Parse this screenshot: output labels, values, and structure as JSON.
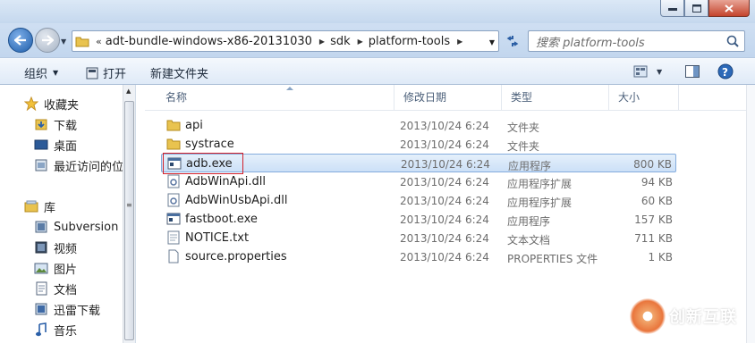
{
  "address": {
    "breadcrumbs": [
      "adt-bundle-windows-x86-20131030",
      "sdk",
      "platform-tools"
    ],
    "lead": "«"
  },
  "search": {
    "placeholder": "搜索 platform-tools"
  },
  "toolbar": {
    "organize": "组织",
    "open": "打开",
    "new_folder": "新建文件夹"
  },
  "nav": {
    "favorites": "收藏夹",
    "downloads": "下载",
    "desktop": "桌面",
    "recent": "最近访问的位置",
    "libraries": "库",
    "subversion": "Subversion",
    "videos": "视频",
    "pictures": "图片",
    "documents": "文档",
    "xunlei": "迅雷下载",
    "music": "音乐"
  },
  "columns": {
    "name": "名称",
    "date": "修改日期",
    "type": "类型",
    "size": "大小"
  },
  "files": [
    {
      "name": "api",
      "date": "2013/10/24 6:24",
      "type": "文件夹",
      "size": "",
      "icon": "folder-icon"
    },
    {
      "name": "systrace",
      "date": "2013/10/24 6:24",
      "type": "文件夹",
      "size": "",
      "icon": "folder-icon"
    },
    {
      "name": "adb.exe",
      "date": "2013/10/24 6:24",
      "type": "应用程序",
      "size": "800 KB",
      "icon": "exe-icon"
    },
    {
      "name": "AdbWinApi.dll",
      "date": "2013/10/24 6:24",
      "type": "应用程序扩展",
      "size": "94 KB",
      "icon": "dll-icon"
    },
    {
      "name": "AdbWinUsbApi.dll",
      "date": "2013/10/24 6:24",
      "type": "应用程序扩展",
      "size": "60 KB",
      "icon": "dll-icon"
    },
    {
      "name": "fastboot.exe",
      "date": "2013/10/24 6:24",
      "type": "应用程序",
      "size": "157 KB",
      "icon": "exe-icon"
    },
    {
      "name": "NOTICE.txt",
      "date": "2013/10/24 6:24",
      "type": "文本文档",
      "size": "711 KB",
      "icon": "txt-icon"
    },
    {
      "name": "source.properties",
      "date": "2013/10/24 6:24",
      "type": "PROPERTIES 文件",
      "size": "1 KB",
      "icon": "file-icon"
    }
  ],
  "watermark": {
    "text": "创新互联"
  },
  "colors": {
    "selection_border": "#84acdd",
    "highlight_box": "#d2202b",
    "title_bar": "#c5d8ee"
  }
}
